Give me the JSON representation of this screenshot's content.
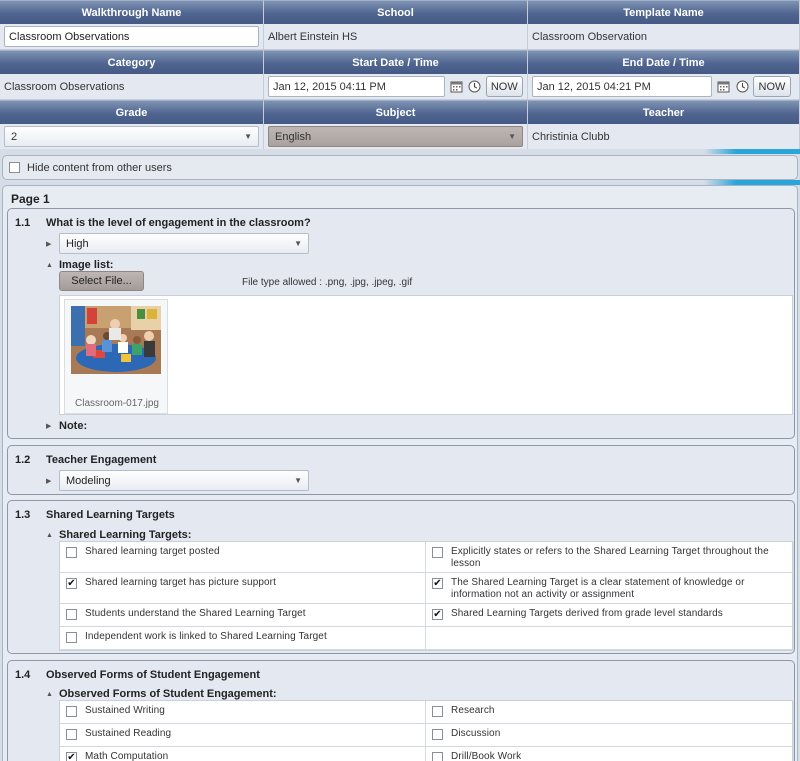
{
  "header": {
    "walkthrough_name_label": "Walkthrough Name",
    "school_label": "School",
    "template_name_label": "Template Name",
    "walkthrough_name_value": "Classroom Observations",
    "school_value": "Albert Einstein HS",
    "template_name_value": "Classroom Observation",
    "category_label": "Category",
    "start_label": "Start Date / Time",
    "end_label": "End Date / Time",
    "category_value": "Classroom Observations",
    "start_value": "Jan 12, 2015 04:11 PM",
    "end_value": "Jan 12, 2015 04:21 PM",
    "now_label": "NOW",
    "grade_label": "Grade",
    "subject_label": "Subject",
    "teacher_label": "Teacher",
    "grade_value": "2",
    "subject_value": "English",
    "teacher_value": "Christinia Clubb"
  },
  "hide_content_label": "Hide content from other users",
  "page_title": "Page 1",
  "q1": {
    "num": "1.1",
    "title": "What is the level of engagement in the classroom?",
    "answer": "High",
    "image_list_label": "Image list:",
    "select_file_label": "Select File...",
    "file_types": "File type allowed : .png, .jpg, .jpeg, .gif",
    "image_caption": "Classroom-017.jpg",
    "note_label": "Note:"
  },
  "q2": {
    "num": "1.2",
    "title": "Teacher Engagement",
    "answer": "Modeling"
  },
  "q3": {
    "num": "1.3",
    "title": "Shared Learning Targets",
    "sub_label": "Shared Learning Targets:",
    "items": [
      {
        "text": "Shared learning target posted",
        "checked": false
      },
      {
        "text": "Explicitly states or refers to the Shared Learning Target throughout the lesson",
        "checked": false
      },
      {
        "text": "Shared learning target has picture support",
        "checked": true
      },
      {
        "text": "The Shared Learning Target is a clear statement of knowledge or information not an activity or assignment",
        "checked": true
      },
      {
        "text": "Students understand the Shared Learning Target",
        "checked": false
      },
      {
        "text": "Shared Learning Targets derived from grade level standards",
        "checked": true
      },
      {
        "text": "Independent work is linked to Shared Learning Target",
        "checked": false
      }
    ]
  },
  "q4": {
    "num": "1.4",
    "title": "Observed Forms of Student Engagement",
    "sub_label": "Observed Forms of Student Engagement:",
    "items": [
      {
        "text": "Sustained Writing",
        "checked": false
      },
      {
        "text": "Research",
        "checked": false
      },
      {
        "text": "Sustained Reading",
        "checked": false
      },
      {
        "text": "Discussion",
        "checked": false
      },
      {
        "text": "Math Computation",
        "checked": true
      },
      {
        "text": "Drill/Book Work",
        "checked": false
      }
    ]
  },
  "colors": {
    "header_blue": "#4f6590",
    "accent_cyan": "#2aa5d9"
  },
  "icons": [
    "calendar-icon",
    "clock-icon",
    "expand-triangle-icon",
    "collapse-triangle-icon",
    "dropdown-caret-icon",
    "checkmark-icon"
  ]
}
